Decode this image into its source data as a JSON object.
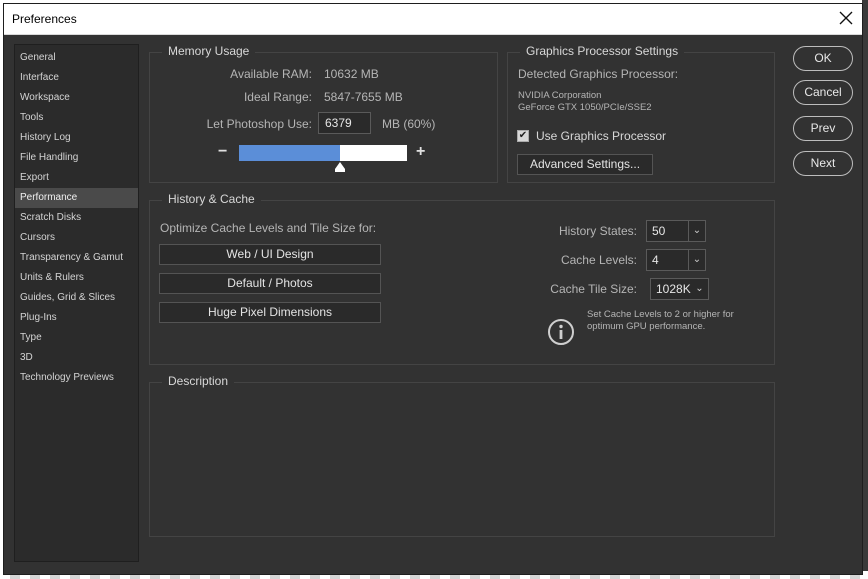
{
  "window": {
    "title": "Preferences"
  },
  "sidebar": {
    "items": [
      {
        "label": "General"
      },
      {
        "label": "Interface"
      },
      {
        "label": "Workspace"
      },
      {
        "label": "Tools"
      },
      {
        "label": "History Log"
      },
      {
        "label": "File Handling"
      },
      {
        "label": "Export"
      },
      {
        "label": "Performance"
      },
      {
        "label": "Scratch Disks"
      },
      {
        "label": "Cursors"
      },
      {
        "label": "Transparency & Gamut"
      },
      {
        "label": "Units & Rulers"
      },
      {
        "label": "Guides, Grid & Slices"
      },
      {
        "label": "Plug-Ins"
      },
      {
        "label": "Type"
      },
      {
        "label": "3D"
      },
      {
        "label": "Technology Previews"
      }
    ],
    "active": "Performance"
  },
  "memory": {
    "title": "Memory Usage",
    "available_label": "Available RAM:",
    "available_value": "10632 MB",
    "ideal_label": "Ideal Range:",
    "ideal_value": "5847-7655 MB",
    "let_label": "Let Photoshop Use:",
    "let_value": "6379",
    "let_unit": "MB (60%)",
    "minus": "−",
    "plus": "+",
    "usage_fraction": 0.6
  },
  "gpu": {
    "title": "Graphics Processor Settings",
    "detected_label": "Detected Graphics Processor:",
    "vendor": "NVIDIA Corporation",
    "model": "GeForce GTX 1050/PCIe/SSE2",
    "use_label": "Use Graphics Processor",
    "use_checked": true,
    "advanced_label": "Advanced Settings..."
  },
  "history": {
    "title": "History & Cache",
    "optimize_label": "Optimize Cache Levels and Tile Size for:",
    "btn_web": "Web / UI Design",
    "btn_default": "Default / Photos",
    "btn_huge": "Huge Pixel Dimensions",
    "states_label": "History States:",
    "states_value": "50",
    "levels_label": "Cache Levels:",
    "levels_value": "4",
    "tile_label": "Cache Tile Size:",
    "tile_value": "1028K",
    "info_line1": "Set Cache Levels to 2 or higher for",
    "info_line2": "optimum GPU performance."
  },
  "description": {
    "title": "Description"
  },
  "buttons": {
    "ok": "OK",
    "cancel": "Cancel",
    "prev": "Prev",
    "next": "Next"
  },
  "icons": {
    "close": "close-icon",
    "info": "info-icon",
    "check": "checkmark-icon",
    "dropdown": "chevron-down-icon"
  },
  "colors": {
    "slider_fill": "#5b8ed8",
    "panel_bg": "#323232"
  }
}
